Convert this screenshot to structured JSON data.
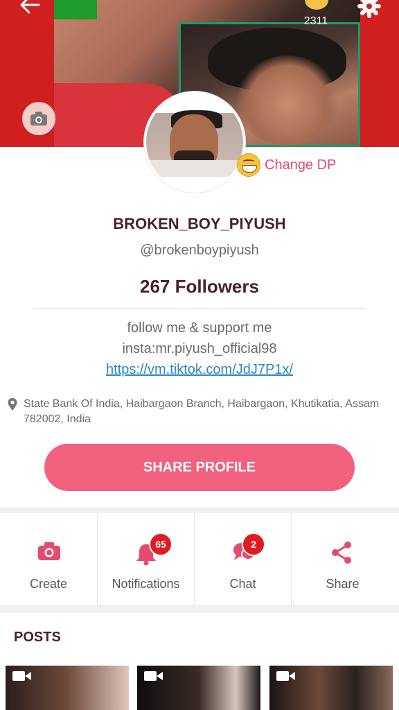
{
  "header": {
    "coin_count": "2311",
    "icons": [
      "back-arrow-icon",
      "coin-icon",
      "gear-icon",
      "camera-icon"
    ]
  },
  "profile": {
    "change_dp_label": "Change DP",
    "username": "BROKEN_BOY_PIYUSH",
    "handle": "@brokenboypiyush",
    "followers": "267 Followers",
    "bio_line_1": "follow me & support me",
    "bio_line_2": "insta:mr.piyush_official98",
    "bio_link": "https://vm.tiktok.com/JdJ7P1x/",
    "location": "State Bank Of India, Haibargaon Branch, Haibargaon, Khutikatia, Assam 782002, India",
    "share_button": "SHARE PROFILE"
  },
  "actions": [
    {
      "label": "Create",
      "icon": "camera-icon",
      "badge": null
    },
    {
      "label": "Notifications",
      "icon": "bell-icon",
      "badge": "65"
    },
    {
      "label": "Chat",
      "icon": "chat-icon",
      "badge": "2"
    },
    {
      "label": "Share",
      "icon": "share-icon",
      "badge": null
    }
  ],
  "posts": {
    "title": "POSTS"
  },
  "colors": {
    "cover_red": "#cf1f1f",
    "accent_pink": "#f2617d",
    "icon_pink": "#e64a6d",
    "badge_red": "#e11b22",
    "link_blue": "#2a86c6",
    "title_dark": "#4a1f2b"
  }
}
